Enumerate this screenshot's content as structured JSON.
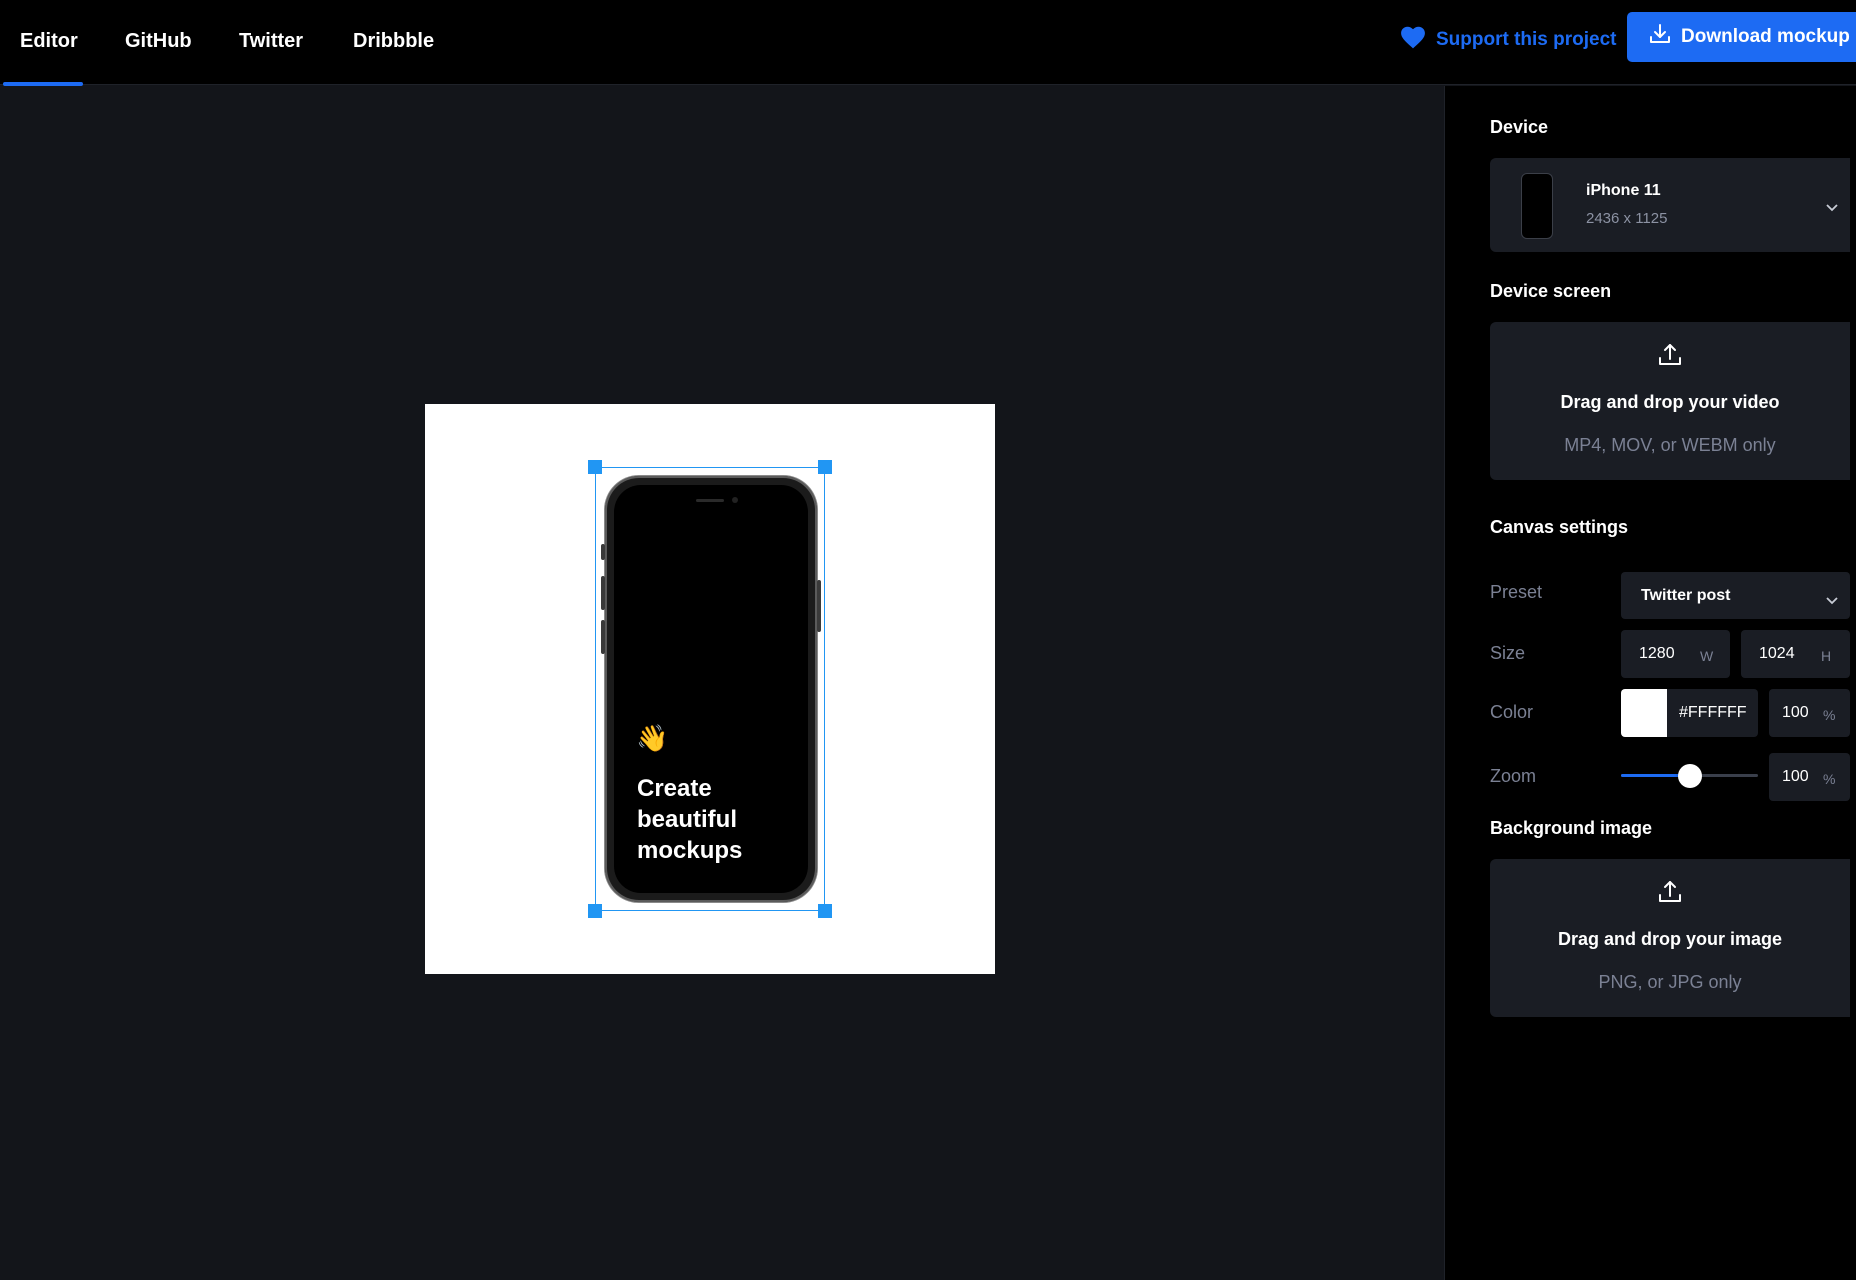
{
  "nav": {
    "tabs": [
      {
        "label": "Editor",
        "active": true
      },
      {
        "label": "GitHub"
      },
      {
        "label": "Twitter"
      },
      {
        "label": "Dribbble"
      }
    ],
    "support_label": "Support this project",
    "download_label": "Download mockup"
  },
  "canvas": {
    "screen_emoji": "👋",
    "screen_text_lines": [
      "Create",
      "beautiful",
      "mockups"
    ],
    "background_color": "#FFFFFF"
  },
  "sidebar": {
    "device_title": "Device",
    "device": {
      "name": "iPhone 11",
      "resolution": "2436 x 1125"
    },
    "device_screen_title": "Device screen",
    "video_drop": {
      "title": "Drag and drop your video",
      "subtitle": "MP4, MOV, or WEBM only"
    },
    "canvas_settings_title": "Canvas settings",
    "preset": {
      "label": "Preset",
      "value": "Twitter post"
    },
    "size": {
      "label": "Size",
      "width": "1280",
      "width_unit": "W",
      "height": "1024",
      "height_unit": "H"
    },
    "color": {
      "label": "Color",
      "hex": "#FFFFFF",
      "opacity": "100",
      "opacity_unit": "%"
    },
    "zoom": {
      "label": "Zoom",
      "value": "100",
      "unit": "%",
      "slider_fraction": 0.5
    },
    "background_image_title": "Background image",
    "image_drop": {
      "title": "Drag and drop your image",
      "subtitle": "PNG, or JPG only"
    }
  },
  "colors": {
    "accent": "#1d6bf3",
    "selection": "#2196f3",
    "panel": "#1a1d24",
    "muted_text": "#7b8194"
  },
  "icons": {
    "support": "heart-icon",
    "download": "download-icon",
    "upload": "upload-icon",
    "dropdown": "chevron-down-icon"
  }
}
